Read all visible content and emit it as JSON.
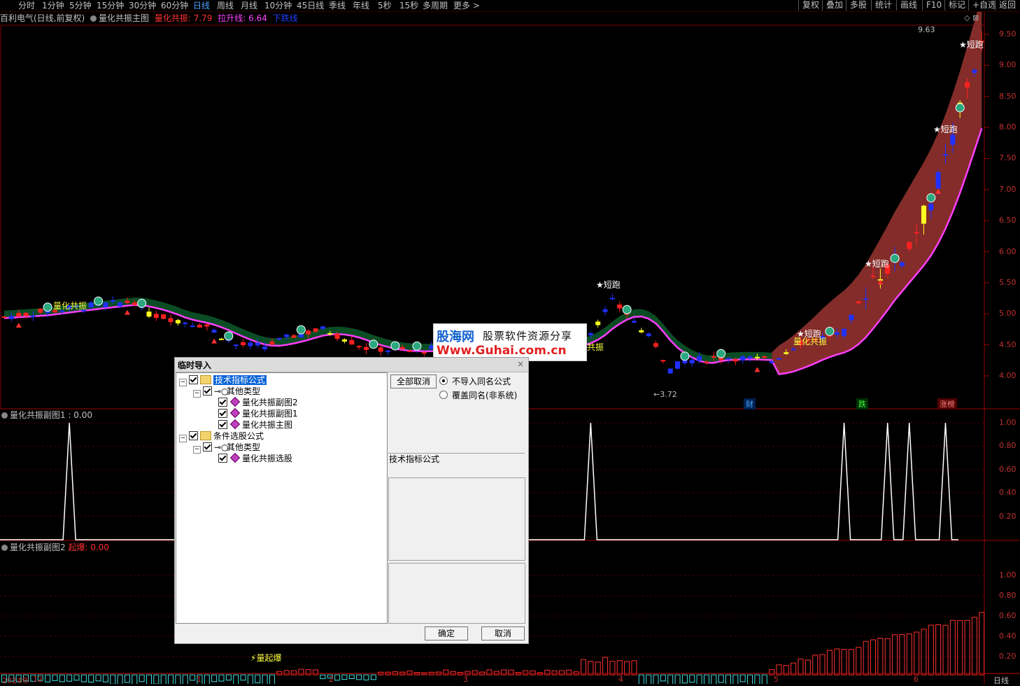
{
  "toolbar": {
    "timeframes": [
      "分时",
      "1分钟",
      "5分钟",
      "15分钟",
      "30分钟",
      "60分钟",
      "日线",
      "周线",
      "月线",
      "10分钟",
      "45日线",
      "季线",
      "年线",
      "5秒",
      "15秒",
      "多周期",
      "更多 >"
    ],
    "active_timeframe": "日线",
    "right_buttons": [
      "复权",
      "叠加",
      "多股",
      "统计",
      "画线",
      "F10",
      "标记",
      "+自选",
      "返回"
    ]
  },
  "main_chart": {
    "stock_title": "百利电气(日线,前复权)",
    "indicator_name": "量化共振主图",
    "legend": [
      {
        "label": "量化共振: 7.79",
        "color": "#ff3030"
      },
      {
        "label": "拉升线: 6.64",
        "color": "#ff40ff"
      },
      {
        "label": "下跌线",
        "color": "#2040ff"
      }
    ],
    "y_ticks": [
      "9.50",
      "9.00",
      "8.50",
      "8.00",
      "7.50",
      "7.00",
      "6.50",
      "6.00",
      "5.50",
      "5.00",
      "4.50",
      "4.00"
    ],
    "high_label": "9.63",
    "low_label": "3.72",
    "markers": [
      "短跑",
      "短跑",
      "短跑",
      "短跑",
      "短跑"
    ],
    "resonance_labels": [
      "量化共振",
      "量化共振",
      "共振"
    ],
    "event_tags": [
      {
        "label": "财",
        "color": "#4aa3ff"
      },
      {
        "label": "跌",
        "color": "#40ff40"
      },
      {
        "label": "涨榜",
        "color": "#ff6060"
      }
    ]
  },
  "sub1": {
    "title": "量化共振副图1 : 0.00",
    "y_ticks": [
      "1.00",
      "0.80",
      "0.60",
      "0.40",
      "0.20"
    ]
  },
  "sub2": {
    "title": "量化共振副图2",
    "legend_label": "起爆: 0.00",
    "y_ticks": [
      "1.00",
      "0.80",
      "0.60",
      "0.40",
      "0.20"
    ],
    "annotation": "量起爆"
  },
  "x_axis": {
    "labels": [
      "2024年",
      "12",
      "1",
      "2",
      "3",
      "4",
      "5",
      "6"
    ],
    "period": "日线"
  },
  "watermark": {
    "brand": "股海网",
    "slogan": "股票软件资源分享",
    "url": "Www.Guhai.com.cn"
  },
  "dialog": {
    "title": "临时导入",
    "close": "×",
    "tree": [
      {
        "label": "技术指标公式",
        "level": 0,
        "type": "folder",
        "selected": true
      },
      {
        "label": "其他类型",
        "level": 1,
        "type": "key"
      },
      {
        "label": "量化共振副图2",
        "level": 2,
        "type": "item"
      },
      {
        "label": "量化共振副图1",
        "level": 2,
        "type": "item"
      },
      {
        "label": "量化共振主图",
        "level": 2,
        "type": "item"
      },
      {
        "label": "条件选股公式",
        "level": 0,
        "type": "folder"
      },
      {
        "label": "其他类型",
        "level": 1,
        "type": "key"
      },
      {
        "label": "量化共振选股",
        "level": 2,
        "type": "item"
      }
    ],
    "cancel_all": "全部取消",
    "radio_no_import": "不导入同名公式",
    "radio_overwrite": "覆盖同名(非系统)",
    "section_label": "技术指标公式",
    "ok": "确定",
    "cancel": "取消"
  }
}
